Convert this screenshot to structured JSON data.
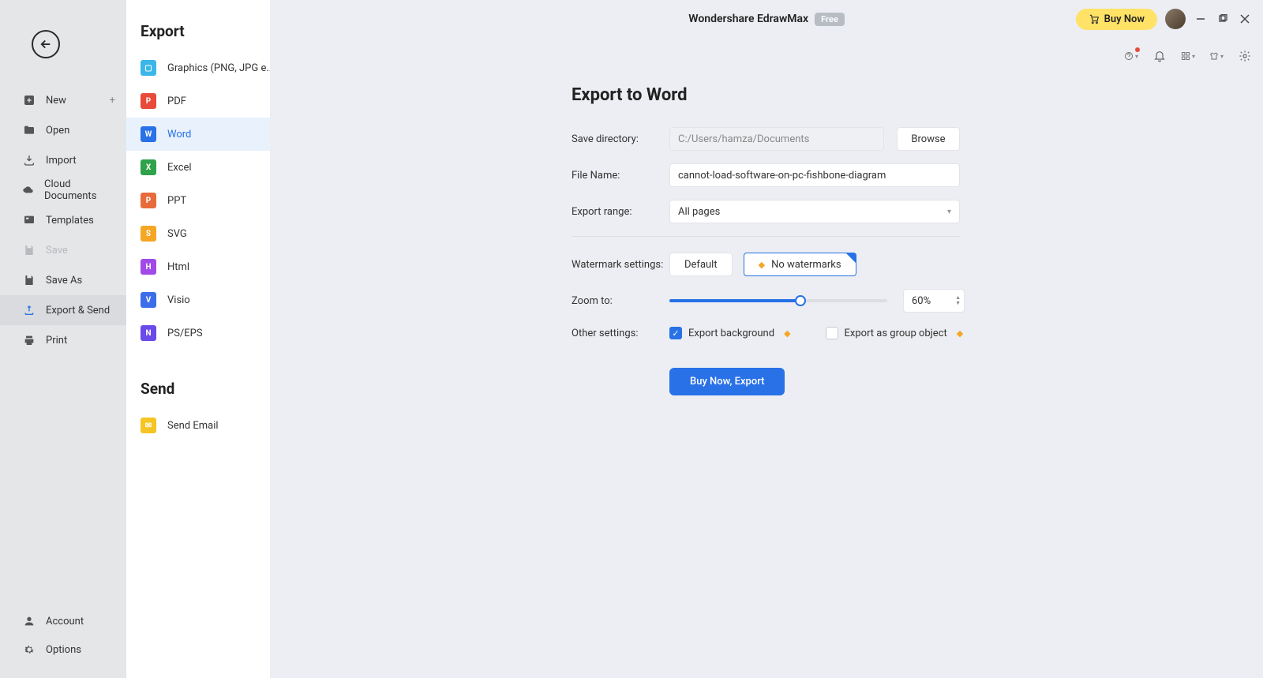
{
  "title": {
    "app": "Wondershare EdrawMax",
    "badge": "Free"
  },
  "headerButtons": {
    "buyNow": "Buy Now"
  },
  "nav": {
    "new": "New",
    "open": "Open",
    "import": "Import",
    "cloud": "Cloud Documents",
    "templates": "Templates",
    "save": "Save",
    "saveAs": "Save As",
    "exportSend": "Export & Send",
    "print": "Print",
    "account": "Account",
    "options": "Options"
  },
  "exportPanel": {
    "heading": "Export",
    "items": {
      "graphics": "Graphics (PNG, JPG e...",
      "pdf": "PDF",
      "word": "Word",
      "excel": "Excel",
      "ppt": "PPT",
      "svg": "SVG",
      "html": "Html",
      "visio": "Visio",
      "pseps": "PS/EPS"
    },
    "sendHeading": "Send",
    "sendEmail": "Send Email"
  },
  "form": {
    "heading": "Export to Word",
    "saveDirLabel": "Save directory:",
    "saveDirValue": "C:/Users/hamza/Documents",
    "browse": "Browse",
    "fileNameLabel": "File Name:",
    "fileNameValue": "cannot-load-software-on-pc-fishbone-diagram",
    "exportRangeLabel": "Export range:",
    "exportRangeValue": "All pages",
    "watermarkLabel": "Watermark settings:",
    "wmDefault": "Default",
    "wmNone": "No watermarks",
    "zoomLabel": "Zoom to:",
    "zoomValue": "60%",
    "otherLabel": "Other settings:",
    "exportBg": "Export background",
    "exportGroup": "Export as group object",
    "submit": "Buy Now, Export"
  },
  "iconColors": {
    "graphics": "#3bb6e8",
    "pdf": "#e84a3b",
    "word": "#2871e6",
    "excel": "#2fa24a",
    "ppt": "#e86c3b",
    "svg": "#f5a623",
    "html": "#a24ae8",
    "visio": "#3b6ee8",
    "pseps": "#6a4ae8",
    "email": "#f5c523"
  }
}
